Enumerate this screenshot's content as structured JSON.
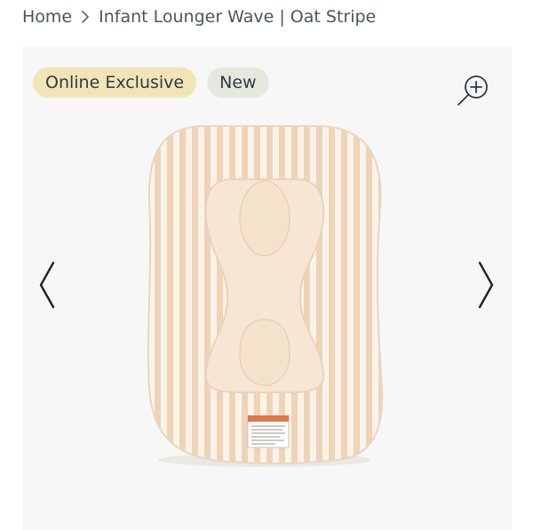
{
  "breadcrumb": {
    "home": "Home",
    "current": "Infant Lounger Wave | Oat Stripe"
  },
  "badges": {
    "exclusive": "Online Exclusive",
    "new": "New"
  },
  "icons": {
    "separator": "chevron-right-icon",
    "zoom": "zoom-in-icon",
    "prev": "chevron-left-icon",
    "next": "chevron-right-icon"
  },
  "colors": {
    "badge_exclusive": "#f1e4b6",
    "badge_new": "#e6e8dd",
    "stripe": "#efd3b6",
    "product_base": "#fbf3ea"
  }
}
